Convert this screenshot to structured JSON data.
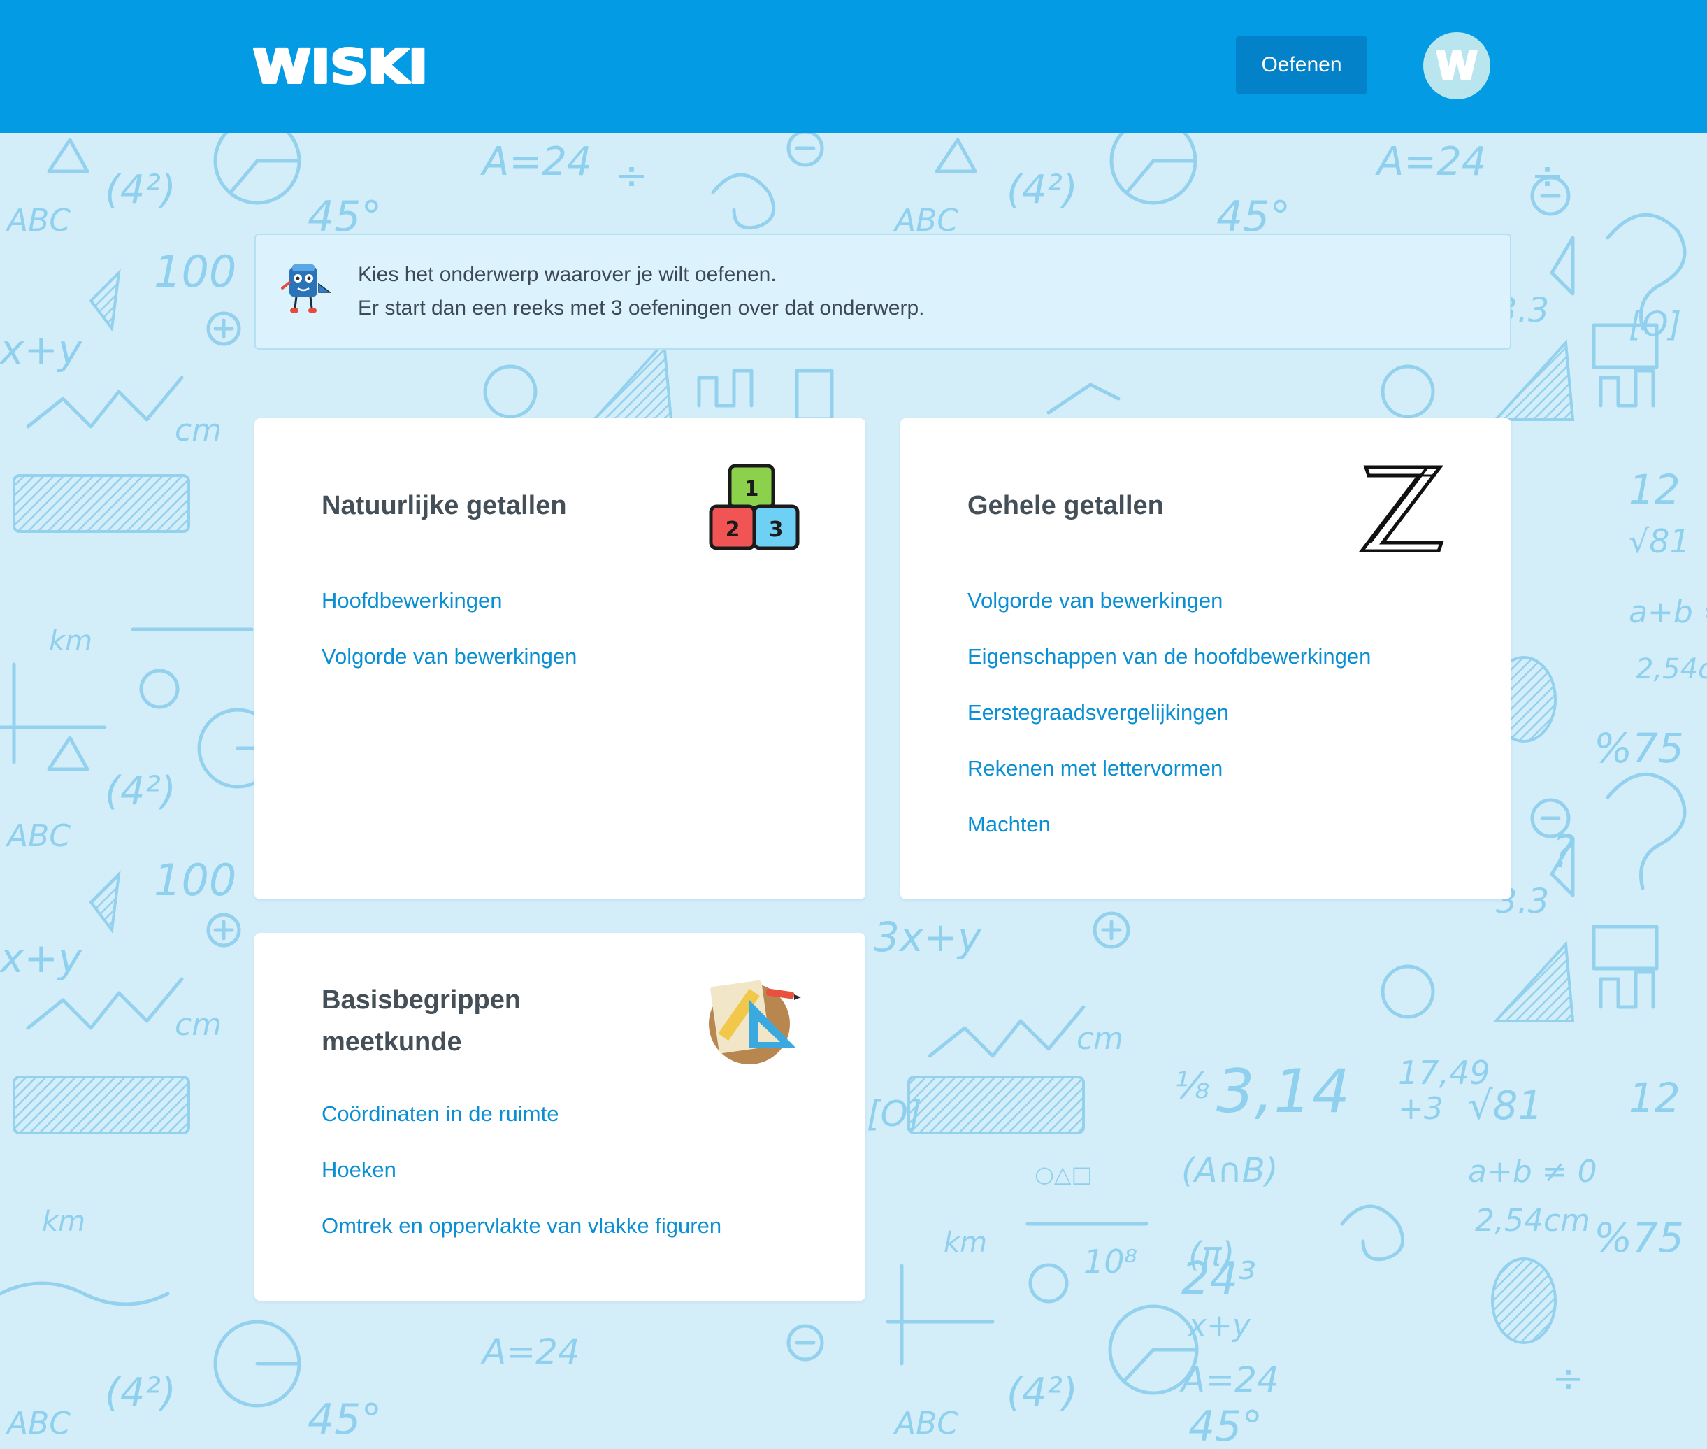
{
  "header": {
    "logo_text": "WISKI",
    "nav_button": "Oefenen",
    "avatar_letter": "W"
  },
  "banner": {
    "line1": "Kies het onderwerp waarover je wilt oefenen.",
    "line2": "Er start dan een reeks met 3 oefeningen over dat onderwerp."
  },
  "cards": [
    {
      "title": "Natuurlijke getallen",
      "icon": "number-blocks-icon",
      "topics": [
        "Hoofdbewerkingen",
        "Volgorde van bewerkingen"
      ]
    },
    {
      "title": "Gehele getallen",
      "icon": "integer-z-icon",
      "icon_text": "ℤ",
      "topics": [
        "Volgorde van bewerkingen",
        "Eigenschappen van de hoofdbewerkingen",
        "Eerstegraadsvergelijkingen",
        "Rekenen met lettervormen",
        "Machten"
      ]
    },
    {
      "title": "Basisbegrippen meetkunde",
      "icon": "geometry-tools-icon",
      "topics": [
        "Coördinaten in de ruimte",
        "Hoeken",
        "Omtrek en oppervlakte van vlakke figuren"
      ]
    }
  ],
  "block_labels": [
    "1",
    "2",
    "3"
  ],
  "background_doodles": [
    "A=24",
    "45°",
    "ABC",
    "100",
    "x+y",
    "cm",
    "km",
    "3,14",
    "12",
    "81",
    "[O]",
    "%75",
    "÷",
    "(A∩B)",
    "a+b",
    "≠",
    "10⁸",
    "24³",
    "2,54 cm",
    "17,49"
  ],
  "colors": {
    "header": "#049be5",
    "nav_button": "#0382c9",
    "link": "#0a8fd3",
    "page_background": "#d4eef9",
    "doodle": "#8fd0ee"
  }
}
